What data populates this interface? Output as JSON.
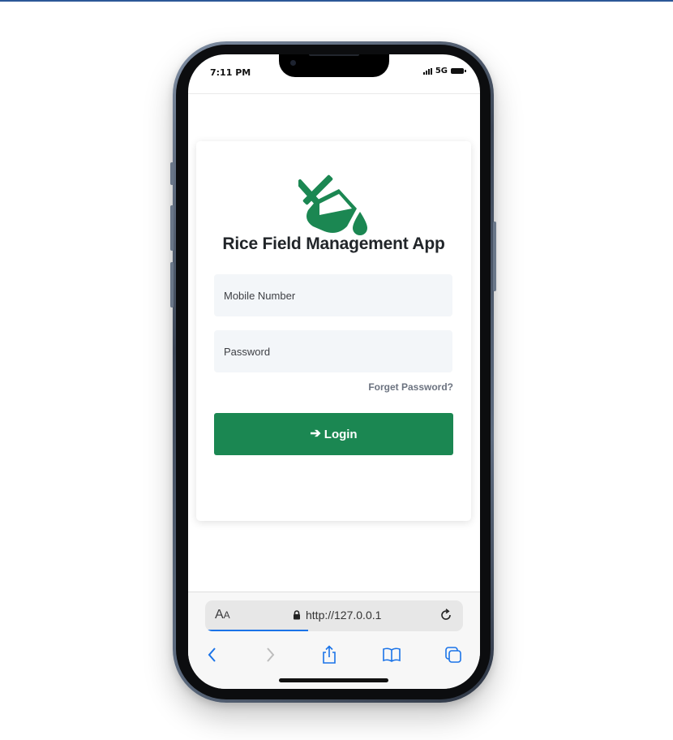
{
  "status_bar": {
    "time": "7:11 PM",
    "network": "5G"
  },
  "login_card": {
    "title": "Rice Field Management App",
    "mobile_placeholder": "Mobile Number",
    "password_placeholder": "Password",
    "forget_password": "Forget Password?",
    "login_label": "Login",
    "brand_color": "#1b8752"
  },
  "browser": {
    "aa_large": "A",
    "aa_small": "A",
    "url": "http://127.0.0.1",
    "load_progress": 0.4,
    "toolbar": [
      "back-icon",
      "forward-icon",
      "share-icon",
      "bookmarks-icon",
      "tabs-icon"
    ]
  }
}
